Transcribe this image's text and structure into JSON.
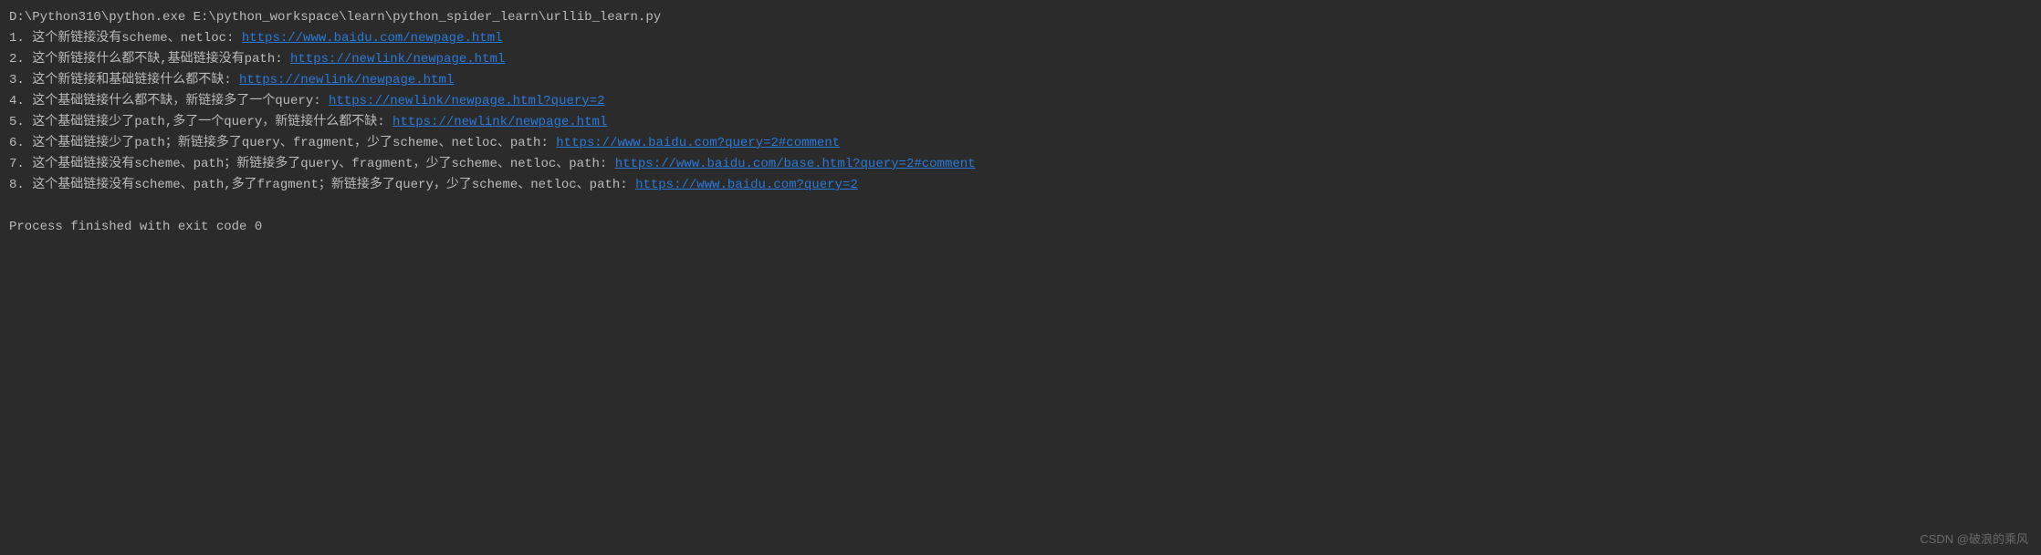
{
  "console": {
    "command": "D:\\Python310\\python.exe E:\\python_workspace\\learn\\python_spider_learn\\urllib_learn.py",
    "lines": [
      {
        "num": "1.",
        "text": "这个新链接没有scheme、netloc:    ",
        "url": "https://www.baidu.com/newpage.html"
      },
      {
        "num": "2.",
        "text": "这个新链接什么都不缺,基础链接没有path:  ",
        "url": "https://newlink/newpage.html"
      },
      {
        "num": "3.",
        "text": "这个新链接和基础链接什么都不缺:    ",
        "url": "https://newlink/newpage.html"
      },
      {
        "num": "4.",
        "text": "这个基础链接什么都不缺，新链接多了一个query:      ",
        "url": "https://newlink/newpage.html?query=2"
      },
      {
        "num": "5.",
        "text": "这个基础链接少了path,多了一个query，新链接什么都不缺:      ",
        "url": "https://newlink/newpage.html"
      },
      {
        "num": "6.",
        "text": "这个基础链接少了path；新链接多了query、fragment，少了scheme、netloc、path:    ",
        "url": "https://www.baidu.com?query=2#comment"
      },
      {
        "num": "7.",
        "text": "这个基础链接没有scheme、path；新链接多了query、fragment，少了scheme、netloc、path:    ",
        "url": "https://www.baidu.com/base.html?query=2#comment"
      },
      {
        "num": "8.",
        "text": "这个基础链接没有scheme、path,多了fragment；新链接多了query，少了scheme、netloc、path:      ",
        "url": "https://www.baidu.com?query=2"
      }
    ],
    "exit_message": "Process finished with exit code 0"
  },
  "watermark": "CSDN @破浪的乘风"
}
